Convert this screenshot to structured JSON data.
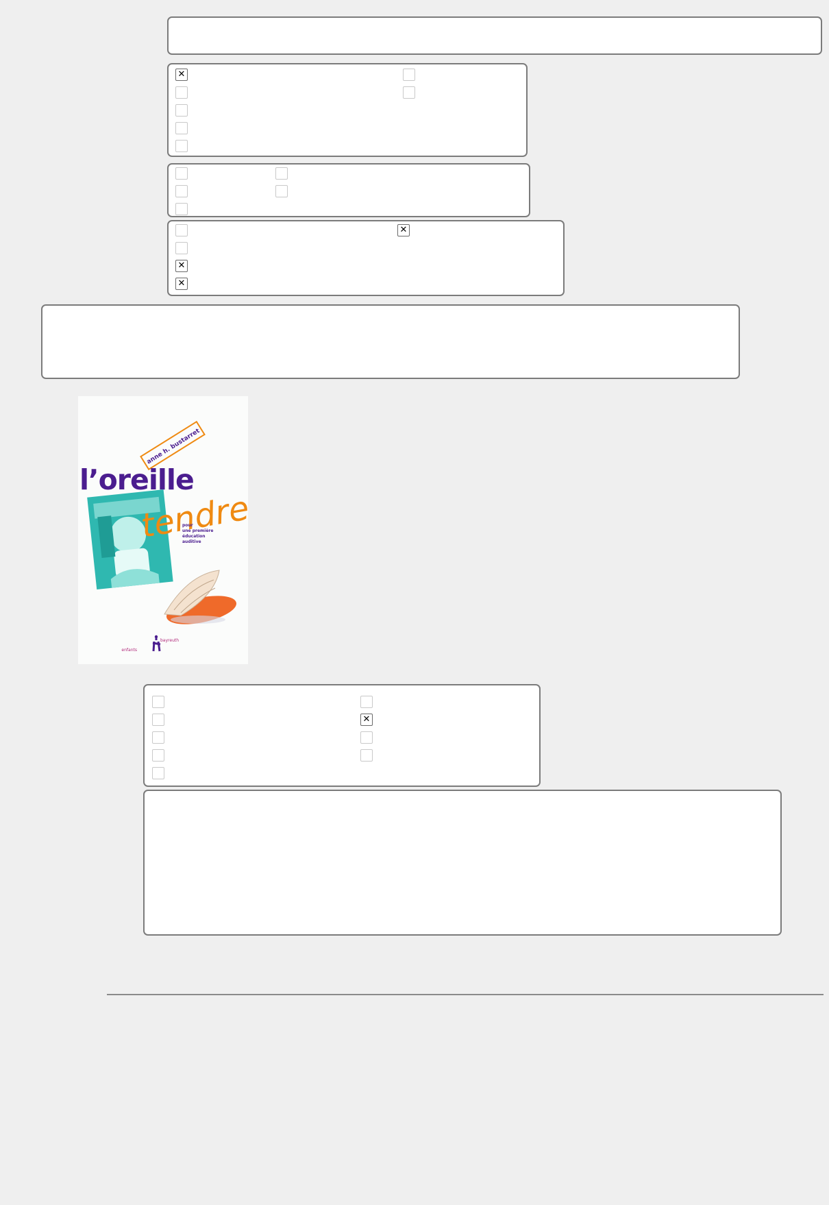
{
  "text_field": {
    "value": ""
  },
  "group_1": {
    "checked": [
      true,
      false,
      false,
      false,
      false,
      false,
      false
    ]
  },
  "group_2": {
    "checked": [
      false,
      false,
      false,
      false,
      false
    ]
  },
  "group_3": {
    "checked": [
      false,
      false,
      true,
      true,
      true
    ]
  },
  "textarea_1": {
    "value": ""
  },
  "book_cover": {
    "author": "anne h. bustarret",
    "title_part1": "l’oreille",
    "title_part2": "tendre",
    "subtitle_lines": [
      "pour",
      "une première",
      "éducation",
      "auditive"
    ],
    "publisher_left": "enfants",
    "publisher_right": "bayreuth"
  },
  "group_4": {
    "checked": [
      false,
      false,
      false,
      false,
      false,
      false,
      true,
      false,
      false
    ]
  },
  "textarea_2": {
    "value": ""
  },
  "colors": {
    "background": "#efefef",
    "border": "#7b7b7b",
    "title_purple": "#4b1d8f",
    "title_orange": "#ef8a12",
    "photo_teal": "#2fb8b0"
  }
}
